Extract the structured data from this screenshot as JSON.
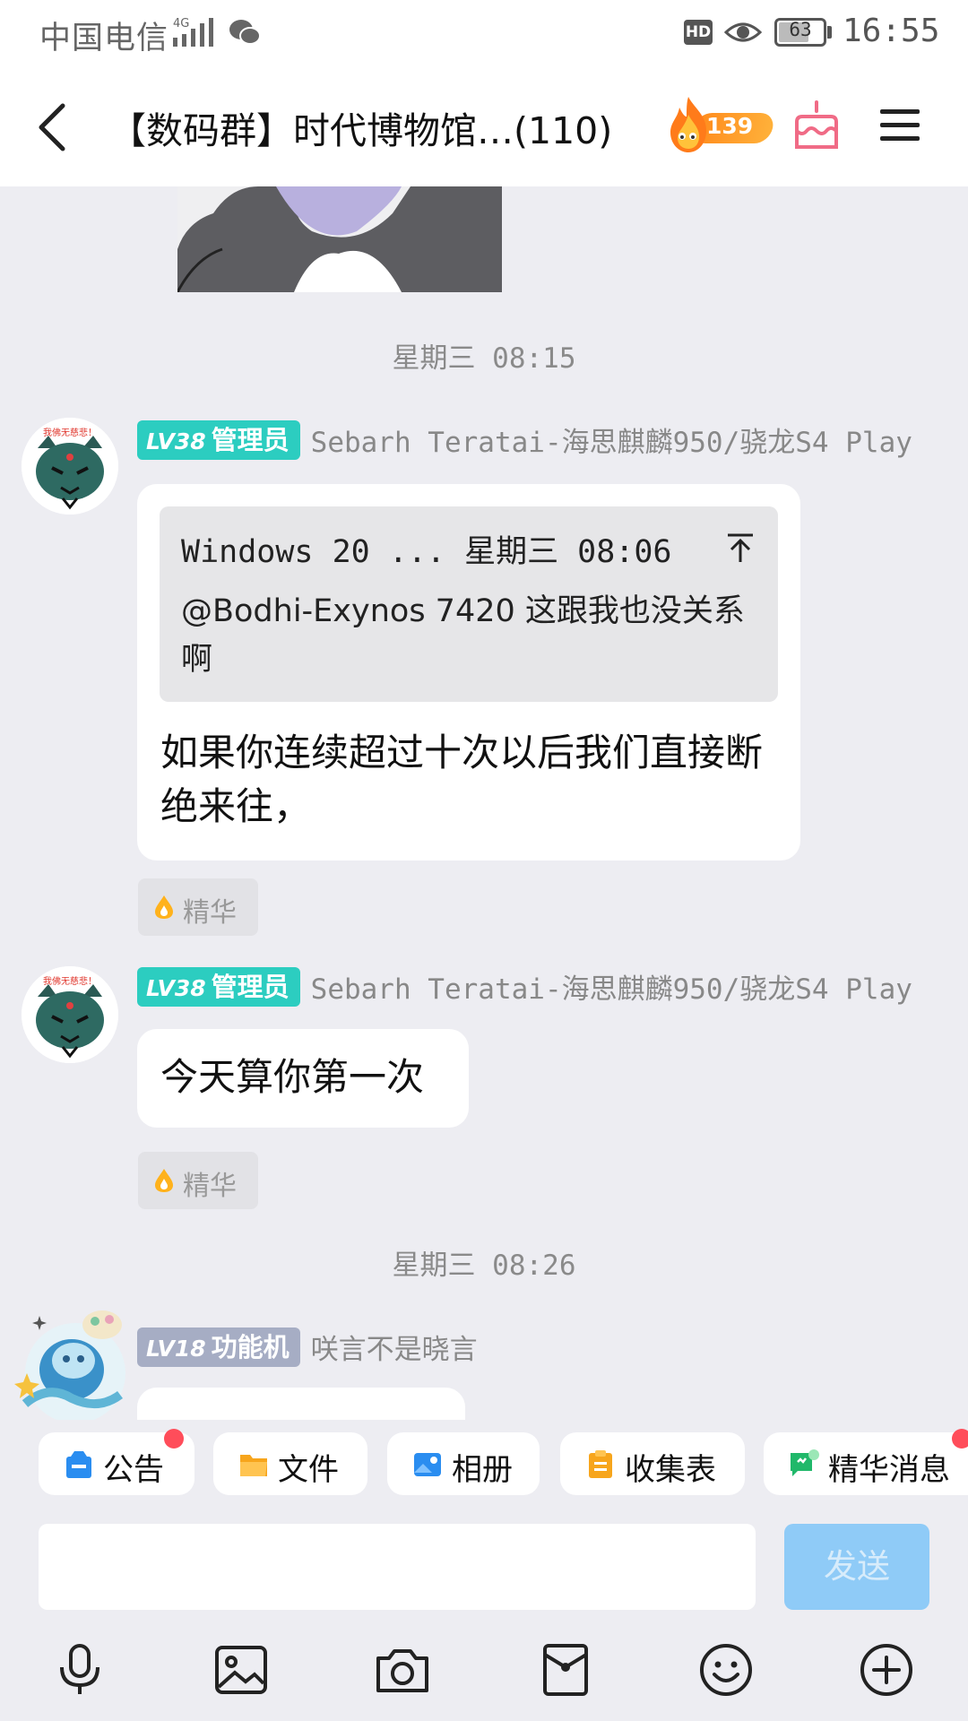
{
  "status_bar": {
    "carrier": "中国电信",
    "network": "4G",
    "hd": "HD",
    "battery": "63",
    "time": "16:55"
  },
  "header": {
    "title": "【数码群】时代博物馆…(110)",
    "fire_count": "139"
  },
  "chat": {
    "time_labels": [
      "星期三 08:15",
      "星期三 08:26"
    ],
    "messages": [
      {
        "level": "LV38",
        "role": "管理员",
        "sender": "Sebarh Teratai-海思麒麟950/骁龙S4 Play",
        "quote": {
          "head": "Windows 20 ... 星期三 08:06",
          "body": "@Bodhi-Exynos 7420 这跟我也没关系啊"
        },
        "text": "如果你连续超过十次以后我们直接断绝来往，",
        "tag": "精华"
      },
      {
        "level": "LV38",
        "role": "管理员",
        "sender": "Sebarh Teratai-海思麒麟950/骁龙S4 Play",
        "text": "今天算你第一次",
        "tag": "精华"
      },
      {
        "level": "LV18",
        "role": "功能机",
        "sender": "咲言不是晓言"
      }
    ],
    "avatar_caption": "我佛无慈悲！"
  },
  "toolbar": {
    "items": [
      "公告",
      "文件",
      "相册",
      "收集表",
      "精华消息"
    ]
  },
  "input": {
    "placeholder": "",
    "send_label": "发送"
  },
  "colors": {
    "accent_teal": "#2ccdc0",
    "send_disabled": "#8fcbf7",
    "badge_red": "#ff4d5a"
  },
  "icons": [
    "back-icon",
    "fire-icon",
    "cake-icon",
    "menu-icon",
    "mic-icon",
    "image-icon",
    "camera-icon",
    "red-packet-icon",
    "emoji-icon",
    "plus-icon"
  ]
}
